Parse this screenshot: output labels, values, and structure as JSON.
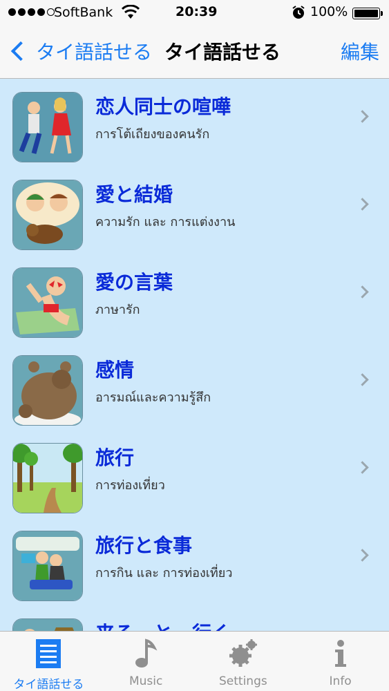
{
  "status": {
    "carrier": "SoftBank",
    "time": "20:39",
    "battery": "100%",
    "battery_level": 1.0
  },
  "nav": {
    "back_label": "タイ語話せる",
    "title": "タイ語話せる",
    "edit_label": "編集"
  },
  "list": [
    {
      "title": "恋人同士の喧嘩",
      "subtitle": "การโต้เถียงของคนรัก"
    },
    {
      "title": "愛と結婚",
      "subtitle": "ความรัก และ การแต่งงาน"
    },
    {
      "title": "愛の言葉",
      "subtitle": "ภาษารัก"
    },
    {
      "title": "感情",
      "subtitle": "อารมณ์และความรู้สึก"
    },
    {
      "title": "旅行",
      "subtitle": "การท่องเที่ยว"
    },
    {
      "title": "旅行と食事",
      "subtitle": "การกิน และ การท่องเที่ยว"
    },
    {
      "title": "来る　と　行く",
      "subtitle": ""
    }
  ],
  "tabs": [
    {
      "label": "タイ語話せる",
      "icon": "list-icon",
      "active": true
    },
    {
      "label": "Music",
      "icon": "music-note-icon",
      "active": false
    },
    {
      "label": "Settings",
      "icon": "gear-icon",
      "active": false
    },
    {
      "label": "Info",
      "icon": "info-icon",
      "active": false
    }
  ],
  "colors": {
    "accent": "#1b7cf2",
    "title_text": "#0a2ad8",
    "list_background": "#cfe9fb"
  }
}
